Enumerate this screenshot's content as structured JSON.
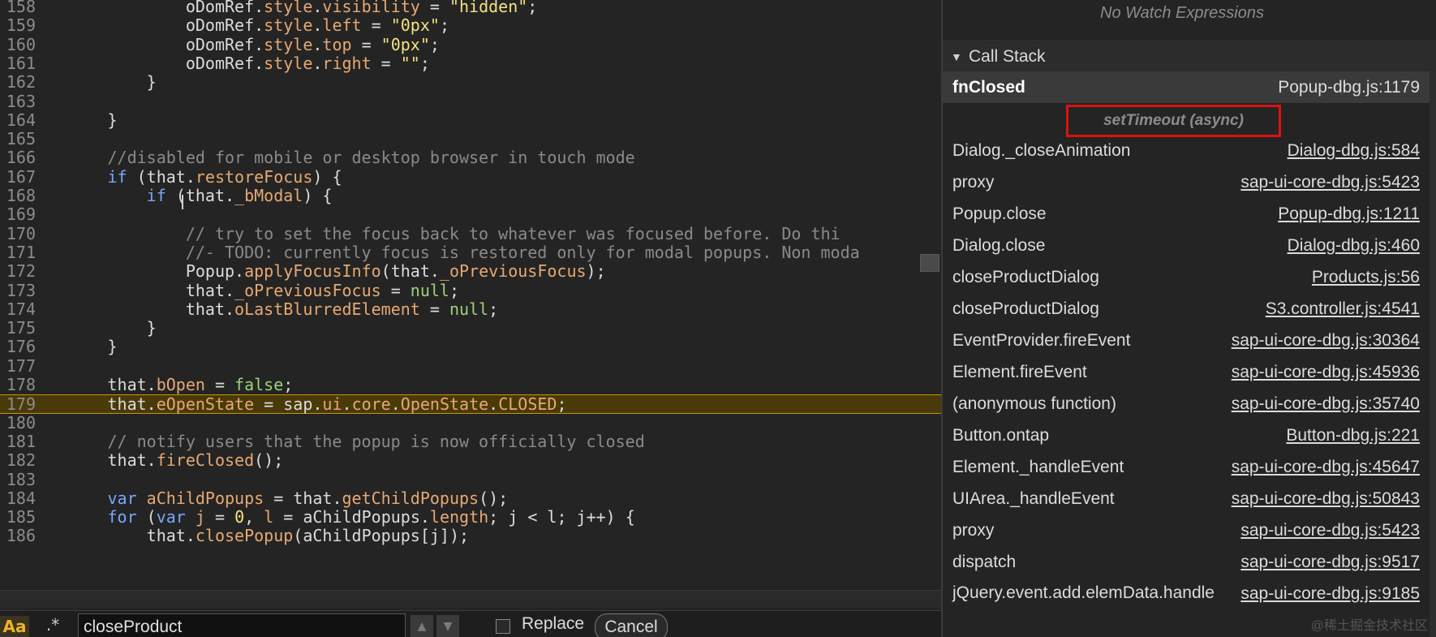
{
  "editor": {
    "lines": [
      {
        "num": "158",
        "tokens": [
          [
            "plain",
            "                    oDomRef."
          ],
          [
            "prop",
            "style"
          ],
          [
            "plain",
            "."
          ],
          [
            "prop",
            "visibility"
          ],
          [
            "plain",
            " = "
          ],
          [
            "str",
            "\"hidden\""
          ],
          [
            "plain",
            ";"
          ]
        ]
      },
      {
        "num": "159",
        "tokens": [
          [
            "plain",
            "                    oDomRef."
          ],
          [
            "prop",
            "style"
          ],
          [
            "plain",
            "."
          ],
          [
            "prop",
            "left"
          ],
          [
            "plain",
            " = "
          ],
          [
            "str",
            "\"0px\""
          ],
          [
            "plain",
            ";"
          ]
        ]
      },
      {
        "num": "160",
        "tokens": [
          [
            "plain",
            "                    oDomRef."
          ],
          [
            "prop",
            "style"
          ],
          [
            "plain",
            "."
          ],
          [
            "prop",
            "top"
          ],
          [
            "plain",
            " = "
          ],
          [
            "str",
            "\"0px\""
          ],
          [
            "plain",
            ";"
          ]
        ]
      },
      {
        "num": "161",
        "tokens": [
          [
            "plain",
            "                    oDomRef."
          ],
          [
            "prop",
            "style"
          ],
          [
            "plain",
            "."
          ],
          [
            "prop",
            "right"
          ],
          [
            "plain",
            " = "
          ],
          [
            "str",
            "\"\""
          ],
          [
            "plain",
            ";"
          ]
        ]
      },
      {
        "num": "162",
        "tokens": [
          [
            "plain",
            "                }"
          ]
        ]
      },
      {
        "num": "163",
        "tokens": []
      },
      {
        "num": "164",
        "tokens": [
          [
            "plain",
            "            }"
          ]
        ]
      },
      {
        "num": "165",
        "tokens": []
      },
      {
        "num": "166",
        "tokens": [
          [
            "comment",
            "            //disabled for mobile or desktop browser in touch mode"
          ]
        ]
      },
      {
        "num": "167",
        "tokens": [
          [
            "kw",
            "            if"
          ],
          [
            "plain",
            " (that."
          ],
          [
            "prop",
            "restoreFocus"
          ],
          [
            "plain",
            ") {"
          ]
        ]
      },
      {
        "num": "168",
        "tokens": [
          [
            "kw",
            "                if"
          ],
          [
            "plain",
            " (that."
          ],
          [
            "prop",
            "_bModal"
          ],
          [
            "plain",
            ") {"
          ]
        ]
      },
      {
        "num": "169",
        "tokens": []
      },
      {
        "num": "170",
        "tokens": [
          [
            "comment",
            "                    // try to set the focus back to whatever was focused before. Do thi"
          ]
        ]
      },
      {
        "num": "171",
        "tokens": [
          [
            "comment",
            "                    //- TODO: currently focus is restored only for modal popups. Non moda"
          ]
        ]
      },
      {
        "num": "172",
        "tokens": [
          [
            "plain",
            "                    Popup."
          ],
          [
            "prop",
            "applyFocusInfo"
          ],
          [
            "plain",
            "(that."
          ],
          [
            "prop",
            "_oPreviousFocus"
          ],
          [
            "plain",
            ");"
          ]
        ]
      },
      {
        "num": "173",
        "tokens": [
          [
            "plain",
            "                    that."
          ],
          [
            "prop",
            "_oPreviousFocus"
          ],
          [
            "plain",
            " = "
          ],
          [
            "const",
            "null"
          ],
          [
            "plain",
            ";"
          ]
        ]
      },
      {
        "num": "174",
        "tokens": [
          [
            "plain",
            "                    that."
          ],
          [
            "prop",
            "oLastBlurredElement"
          ],
          [
            "plain",
            " = "
          ],
          [
            "const",
            "null"
          ],
          [
            "plain",
            ";"
          ]
        ]
      },
      {
        "num": "175",
        "tokens": [
          [
            "plain",
            "                }"
          ]
        ]
      },
      {
        "num": "176",
        "tokens": [
          [
            "plain",
            "            }"
          ]
        ]
      },
      {
        "num": "177",
        "tokens": []
      },
      {
        "num": "178",
        "tokens": [
          [
            "plain",
            "            that."
          ],
          [
            "prop",
            "bOpen"
          ],
          [
            "plain",
            " = "
          ],
          [
            "const",
            "false"
          ],
          [
            "plain",
            ";"
          ]
        ]
      },
      {
        "num": "179",
        "current": true,
        "tokens": [
          [
            "plain",
            "            that."
          ],
          [
            "prop",
            "eOpenState"
          ],
          [
            "plain",
            " = sap."
          ],
          [
            "prop",
            "ui"
          ],
          [
            "plain",
            "."
          ],
          [
            "prop",
            "core"
          ],
          [
            "plain",
            "."
          ],
          [
            "prop",
            "OpenState"
          ],
          [
            "plain",
            "."
          ],
          [
            "prop",
            "CLOSED"
          ],
          [
            "plain",
            ";"
          ]
        ]
      },
      {
        "num": "180",
        "tokens": []
      },
      {
        "num": "181",
        "tokens": [
          [
            "comment",
            "            // notify users that the popup is now officially closed"
          ]
        ]
      },
      {
        "num": "182",
        "tokens": [
          [
            "plain",
            "            that."
          ],
          [
            "prop",
            "fireClosed"
          ],
          [
            "plain",
            "();"
          ]
        ]
      },
      {
        "num": "183",
        "tokens": []
      },
      {
        "num": "184",
        "tokens": [
          [
            "kw",
            "            var"
          ],
          [
            "plain",
            " "
          ],
          [
            "prop",
            "aChildPopups"
          ],
          [
            "plain",
            " = that."
          ],
          [
            "prop",
            "getChildPopups"
          ],
          [
            "plain",
            "();"
          ]
        ]
      },
      {
        "num": "185",
        "tokens": [
          [
            "kw",
            "            for"
          ],
          [
            "plain",
            " ("
          ],
          [
            "kw",
            "var"
          ],
          [
            "plain",
            " "
          ],
          [
            "prop",
            "j"
          ],
          [
            "plain",
            " = "
          ],
          [
            "num",
            "0"
          ],
          [
            "plain",
            ", "
          ],
          [
            "prop",
            "l"
          ],
          [
            "plain",
            " = aChildPopups."
          ],
          [
            "prop",
            "length"
          ],
          [
            "plain",
            "; j < l; j++) {"
          ]
        ]
      },
      {
        "num": "186",
        "tokens": [
          [
            "plain",
            "                that."
          ],
          [
            "prop",
            "closePopup"
          ],
          [
            "plain",
            "(aChildPopups[j]);"
          ]
        ]
      }
    ]
  },
  "find_bar": {
    "case_label": "Aa",
    "regex_label": ".*",
    "query": "closeProduct",
    "prev_icon": "chevron-up-icon",
    "next_icon": "chevron-down-icon",
    "replace_label": "Replace",
    "cancel_label": "Cancel"
  },
  "watch": {
    "empty_text": "No Watch Expressions"
  },
  "call_stack": {
    "title": "Call Stack",
    "toggle_icon": "triangle-down-icon",
    "frames": [
      {
        "name": "fnClosed",
        "location": "Popup-dbg.js:1179",
        "selected": true
      },
      {
        "async": "setTimeout (async)"
      },
      {
        "name": "Dialog._closeAnimation",
        "location": "Dialog-dbg.js:584"
      },
      {
        "name": "proxy",
        "location": "sap-ui-core-dbg.js:5423"
      },
      {
        "name": "Popup.close",
        "location": "Popup-dbg.js:1211"
      },
      {
        "name": "Dialog.close",
        "location": "Dialog-dbg.js:460"
      },
      {
        "name": "closeProductDialog",
        "location": "Products.js:56"
      },
      {
        "name": "closeProductDialog",
        "location": "S3.controller.js:4541"
      },
      {
        "name": "EventProvider.fireEvent",
        "location": "sap-ui-core-dbg.js:30364"
      },
      {
        "name": "Element.fireEvent",
        "location": "sap-ui-core-dbg.js:45936"
      },
      {
        "name": "(anonymous function)",
        "location": "sap-ui-core-dbg.js:35740"
      },
      {
        "name": "Button.ontap",
        "location": "Button-dbg.js:221"
      },
      {
        "name": "Element._handleEvent",
        "location": "sap-ui-core-dbg.js:45647"
      },
      {
        "name": "UIArea._handleEvent",
        "location": "sap-ui-core-dbg.js:50843"
      },
      {
        "name": "proxy",
        "location": "sap-ui-core-dbg.js:5423"
      },
      {
        "name": "dispatch",
        "location": "sap-ui-core-dbg.js:9517"
      },
      {
        "name": "jQuery.event.add.elemData.handle",
        "location": "sap-ui-core-dbg.js:9185",
        "tall": true
      }
    ]
  },
  "watermark": "@稀土掘金技术社区",
  "colors": {
    "current_line_bg": "#4a3a0a",
    "current_line_border": "#c59600",
    "async_highlight": "#e01010",
    "keyword": "#7aa6ff",
    "string": "#f6e27f",
    "comment": "#8a8a8a",
    "property": "#e7a972",
    "constant": "#9ed17b"
  }
}
